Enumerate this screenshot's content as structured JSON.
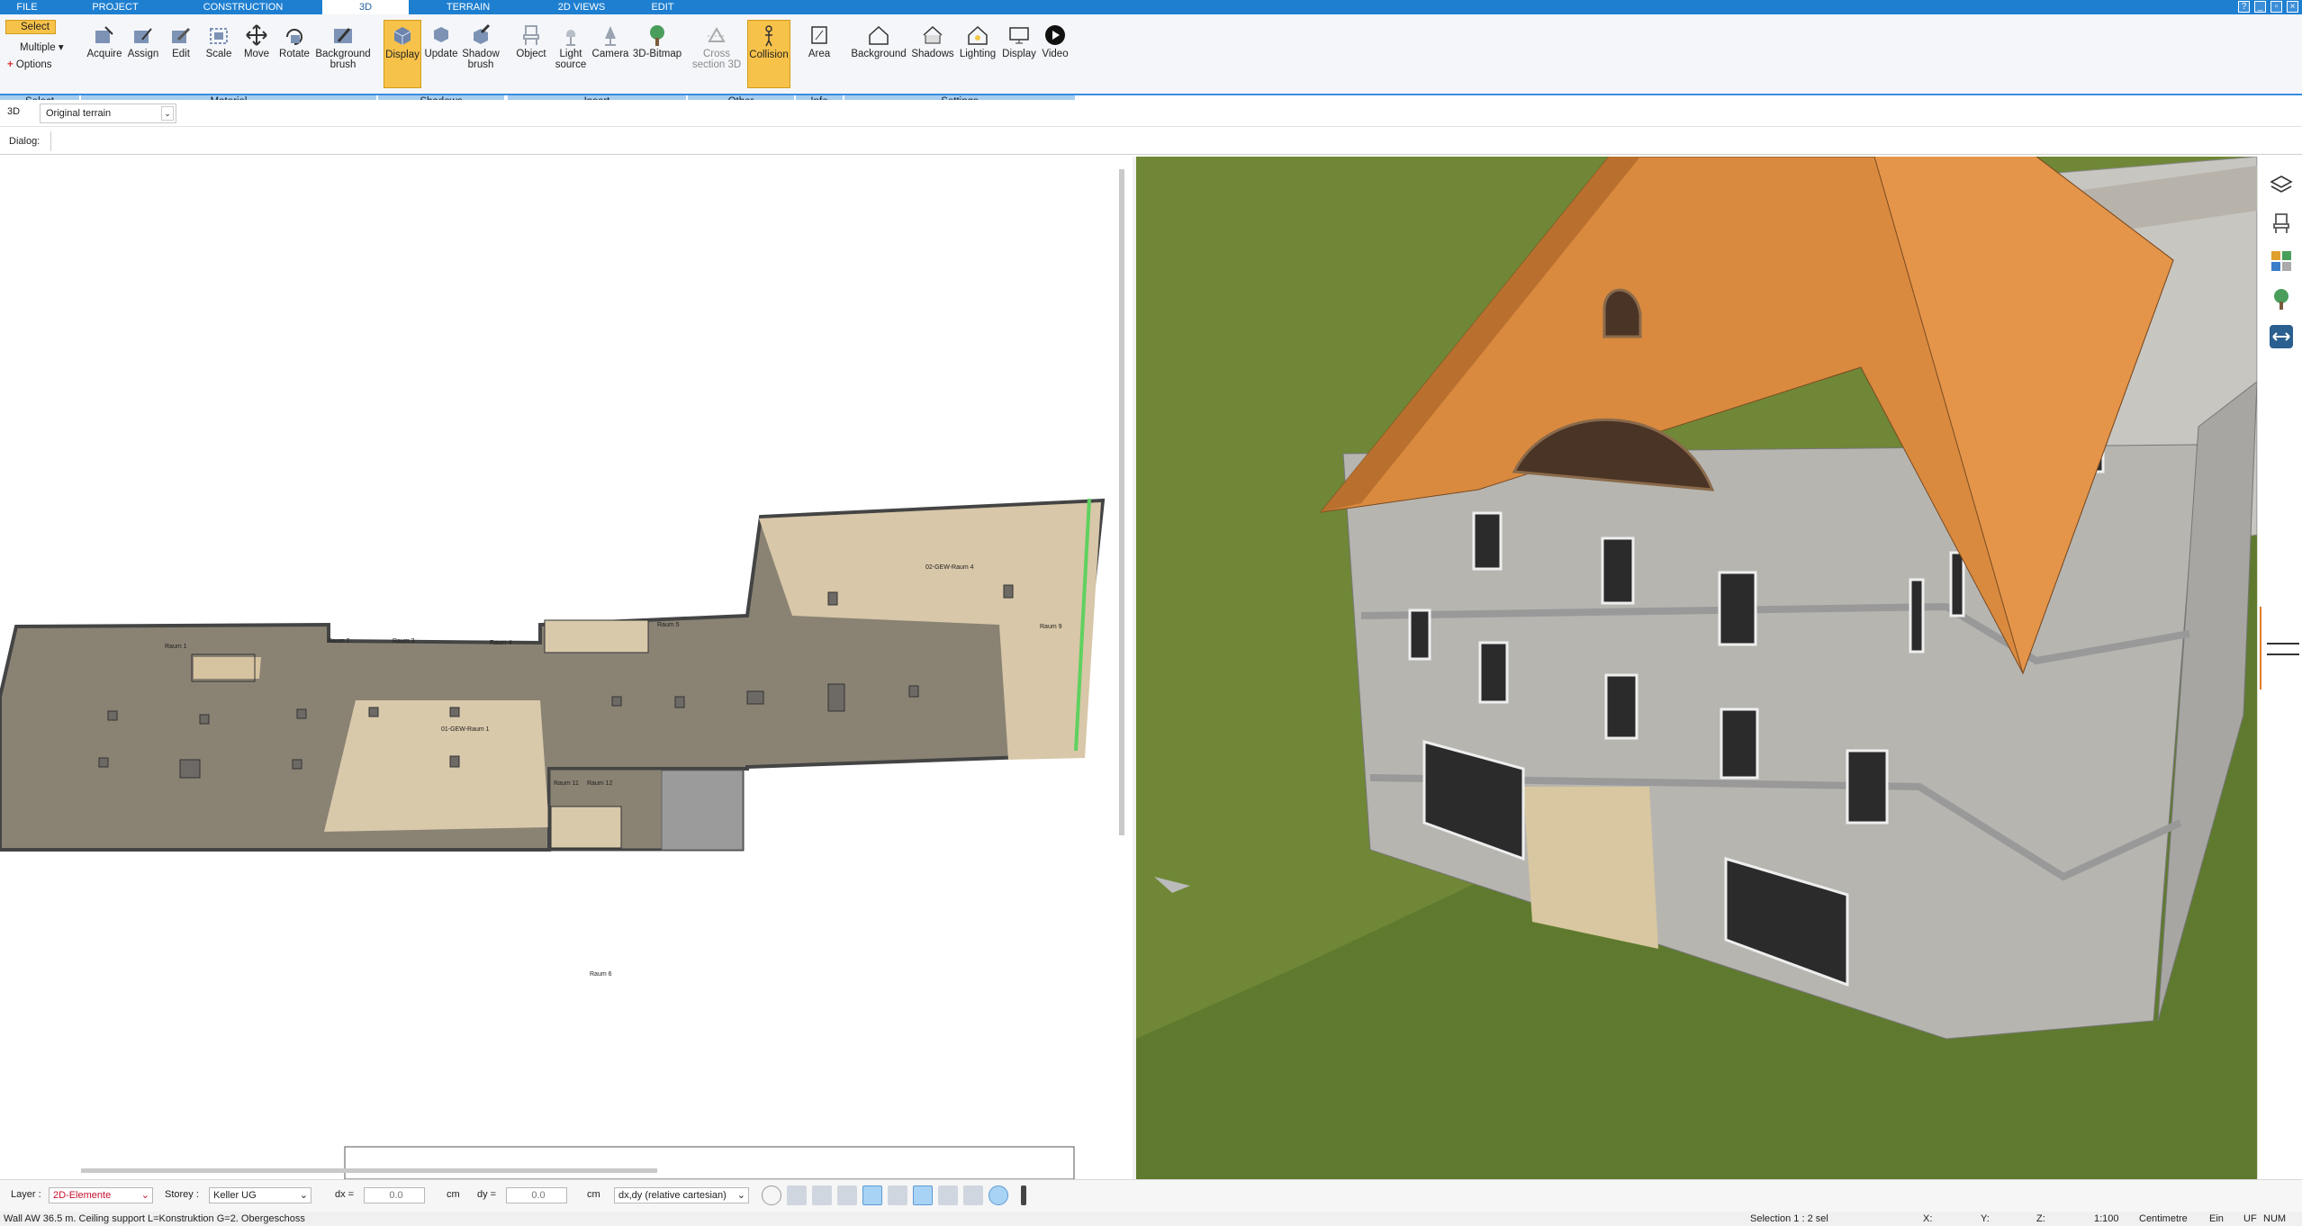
{
  "tabs": [
    {
      "label": "FILE",
      "active": false
    },
    {
      "label": "PROJECT",
      "active": false
    },
    {
      "label": "CONSTRUCTION",
      "active": false
    },
    {
      "label": "3D",
      "active": true
    },
    {
      "label": "TERRAIN",
      "active": false
    },
    {
      "label": "2D VIEWS",
      "active": false
    },
    {
      "label": "EDIT",
      "active": false
    }
  ],
  "ribbon": {
    "select": {
      "select_label": "Select",
      "multiple_label": "Multiple",
      "options_label": "Options",
      "group": "Select"
    },
    "material": {
      "group": "Material",
      "buttons": [
        "Acquire",
        "Assign",
        "Edit",
        "Scale",
        "Move",
        "Rotate",
        "Background brush"
      ]
    },
    "shadows": {
      "group": "Shadows",
      "buttons": [
        "Display",
        "Update",
        "Shadow brush"
      ]
    },
    "insert": {
      "group": "Insert",
      "buttons": [
        "Object",
        "Light source",
        "Camera",
        "3D-Bitmap"
      ]
    },
    "other": {
      "group": "Other",
      "buttons": [
        "Cross section 3D",
        "Collision"
      ]
    },
    "info": {
      "group": "Info",
      "buttons": [
        "Area"
      ]
    },
    "settings": {
      "group": "Settings",
      "buttons": [
        "Background",
        "Shadows",
        "Lighting",
        "Display",
        "Video"
      ]
    }
  },
  "toolbar": {
    "view_label": "3D",
    "terrain_select": "Original terrain",
    "dialog_label": "Dialog:"
  },
  "plan": {
    "rooms": [
      "Raum 1",
      "Raum 2",
      "Raum 3",
      "Raum 4",
      "Raum 5",
      "Raum 6",
      "Raum 9",
      "Raum 11",
      "Raum 12"
    ],
    "main_room_label": "01-GEW-Raum 1",
    "upper_room_label": "02-GEW-Raum 4"
  },
  "bottom": {
    "layer_label": "Layer :",
    "layer_value": "2D-Elemente",
    "storey_label": "Storey :",
    "storey_value": "Keller UG",
    "dx_label": "dx =",
    "dx_value": "0.0",
    "dx_unit": "cm",
    "dy_label": "dy =",
    "dy_value": "0.0",
    "dy_unit": "cm",
    "coord_mode": "dx,dy (relative cartesian)"
  },
  "status": {
    "message": "Wall AW 36.5 m. Ceiling support L=Konstruktion G=2. Obergeschoss",
    "selection": "Selection  1 : 2 sel",
    "x": "X:",
    "y": "Y:",
    "z": "Z:",
    "scale": "1:100",
    "unit": "Centimetre",
    "mode": "Ein",
    "uf": "UF",
    "num": "NUM"
  },
  "colors": {
    "accent": "#1e7fd1",
    "active_button": "#f7c24a",
    "group_bar": "#a6cdef",
    "roof": "#d9833a",
    "grass": "#7a8f3a"
  }
}
